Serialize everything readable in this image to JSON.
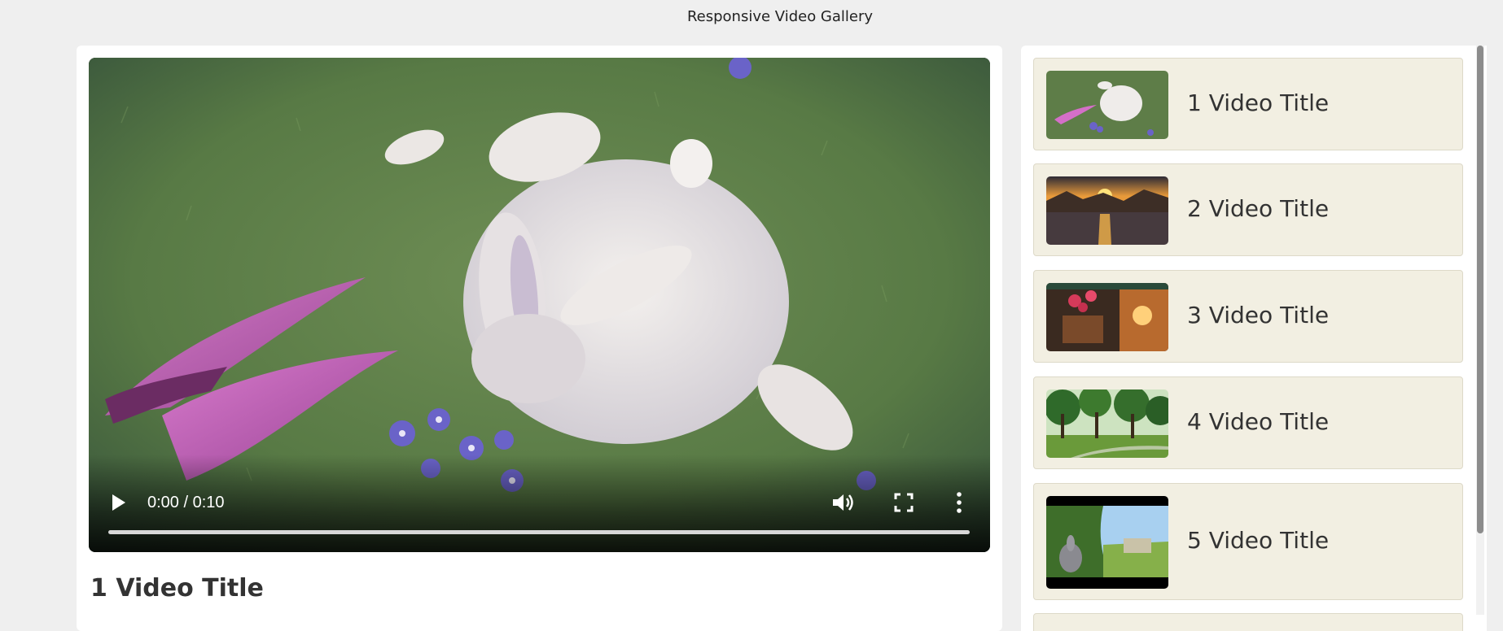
{
  "page": {
    "title": "Responsive Video Gallery"
  },
  "player": {
    "time": "0:00 / 0:10",
    "progress": 0,
    "current_title": "1 Video Title",
    "frame_icon": "big-buck-bunny-frame"
  },
  "playlist": [
    {
      "title": "1 Video Title",
      "thumb": "bunny-meadow"
    },
    {
      "title": "2 Video Title",
      "thumb": "sunset-lake"
    },
    {
      "title": "3 Video Title",
      "thumb": "flower-pot-sunset"
    },
    {
      "title": "4 Video Title",
      "thumb": "green-park"
    },
    {
      "title": "5 Video Title",
      "thumb": "bunny-burrow"
    }
  ],
  "colors": {
    "background": "#efefef",
    "panel": "#ffffff",
    "playlist_item": "#f2efe2"
  }
}
